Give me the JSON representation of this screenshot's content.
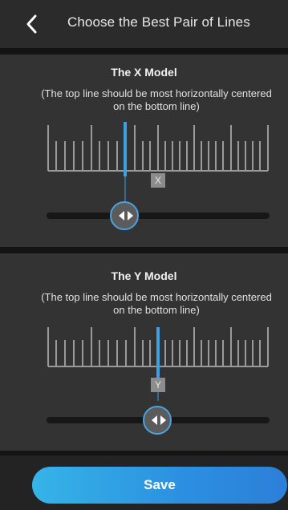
{
  "header": {
    "title": "Choose the Best Pair of Lines"
  },
  "x_model": {
    "title": "The X Model",
    "description": "(The top line should be most horizontally centered on the bottom line)",
    "badge": "X"
  },
  "y_model": {
    "title": "The Y Model",
    "description": "(The top line should be most horizontally centered on the bottom line)",
    "badge": "Y"
  },
  "footer": {
    "save_label": "Save"
  },
  "colors": {
    "accent": "#3ea0e4",
    "tick": "#9a9a9a",
    "panel": "#333333"
  }
}
